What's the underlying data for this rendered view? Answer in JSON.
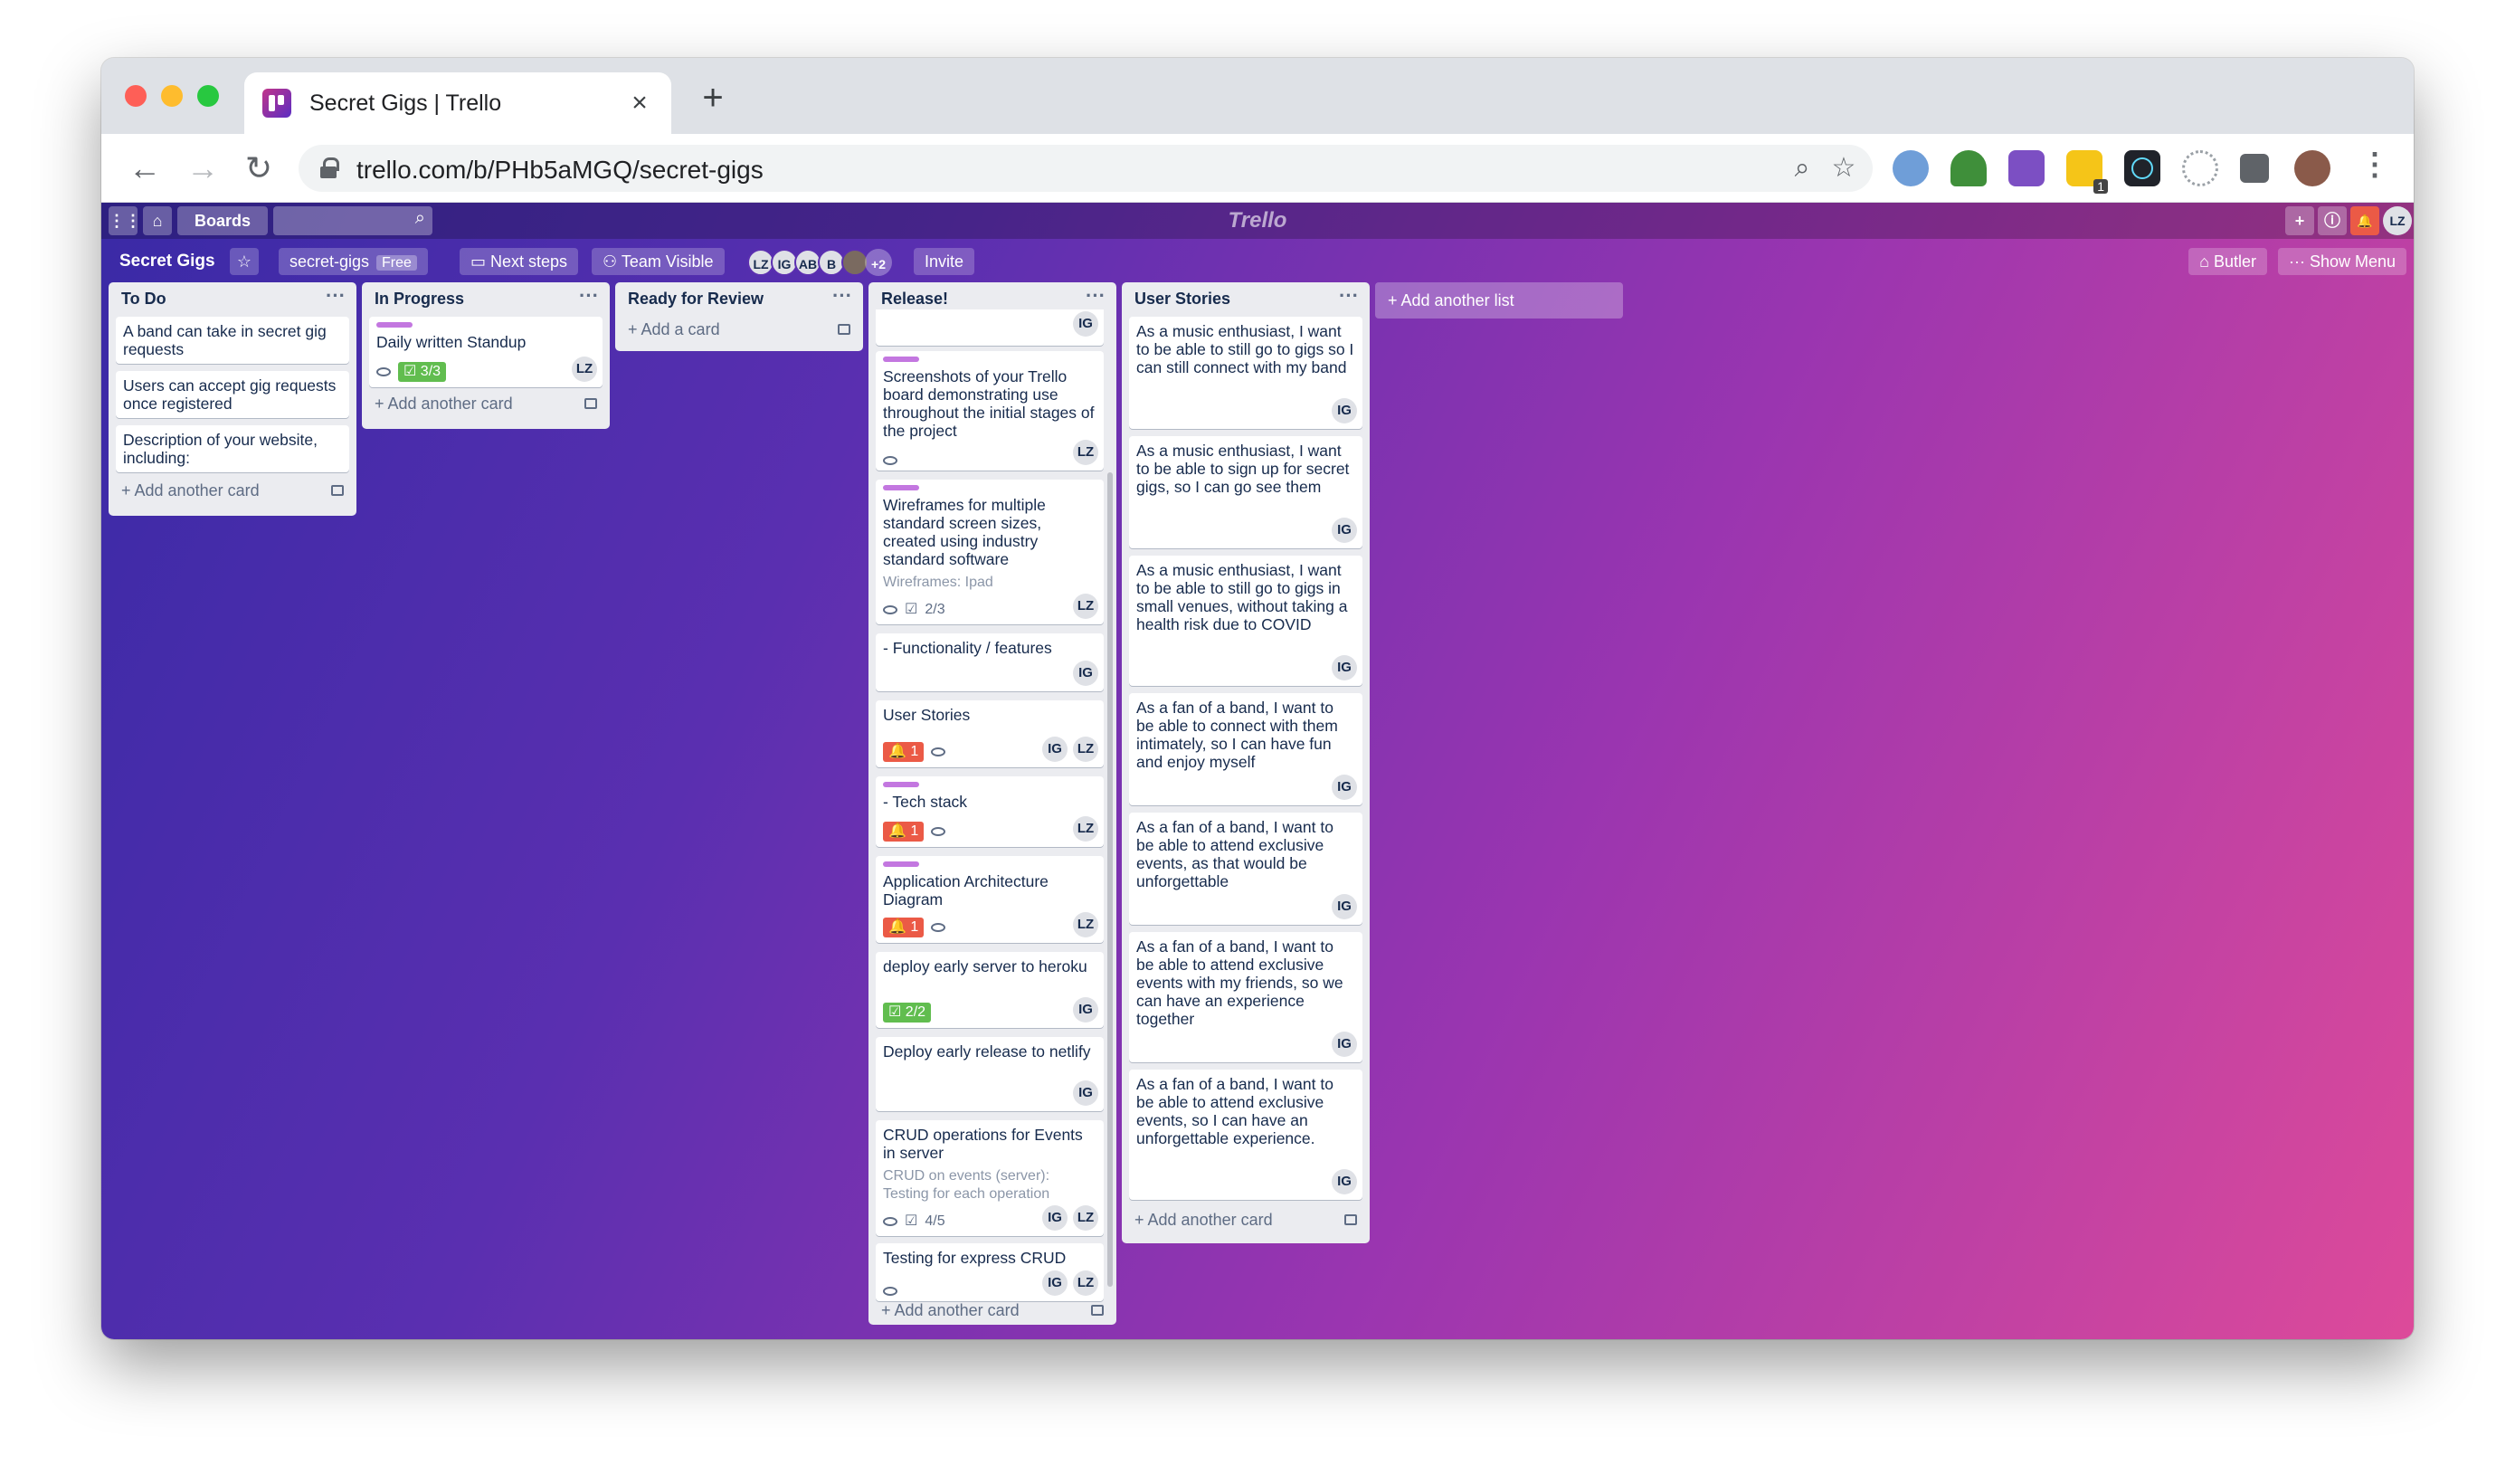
{
  "browser": {
    "tab_title": "Secret Gigs | Trello",
    "tab_close": "×",
    "new_tab": "+",
    "url": "trello.com/b/PHb5aMGQ/secret-gigs",
    "back": "←",
    "forward": "→",
    "reload": "↻",
    "zoom_icon": "⌕",
    "star_icon": "☆",
    "extension_badge": "1",
    "menu": "⋮"
  },
  "header": {
    "boards_label": "Boards",
    "logo": "Trello",
    "user_initials": "LZ",
    "search_icon": "⌕",
    "add_icon": "+",
    "info_icon": "ⓘ",
    "bell_icon": "🔔"
  },
  "board_bar": {
    "board_name": "Secret Gigs",
    "star": "☆",
    "team_name": "secret-gigs",
    "plan": "Free",
    "next_steps": "Next steps",
    "visibility": "Team Visible",
    "members": [
      "LZ",
      "IG",
      "AB",
      "B"
    ],
    "more_members": "+2",
    "invite": "Invite",
    "butler": "Butler",
    "show_menu": "Show Menu"
  },
  "lists": [
    {
      "title": "To Do",
      "cards": [
        {
          "text": "A band can take in secret gig requests"
        },
        {
          "text": "Users can accept gig requests once registered"
        },
        {
          "text": "Description of your website, including:"
        }
      ],
      "add_label": "+ Add another card"
    },
    {
      "title": "In Progress",
      "cards": [
        {
          "text": "Daily written Standup",
          "checklist": "3/3",
          "member": "LZ"
        }
      ],
      "add_label": "+ Add another card"
    },
    {
      "title": "Ready for Review",
      "cards": [],
      "add_label": "+ Add a card"
    },
    {
      "title": "Release!",
      "cards": [
        {
          "text": "",
          "members": [
            "IG"
          ]
        },
        {
          "text": "Screenshots of your Trello board demonstrating use throughout the initial stages of the project",
          "members": [
            "LZ"
          ]
        },
        {
          "text": "Wireframes for multiple standard screen sizes, created using industry standard software",
          "sub": "Wireframes: Ipad",
          "checklist": "2/3",
          "members": [
            "LZ"
          ]
        },
        {
          "text": "- Functionality / features",
          "members": [
            "IG"
          ]
        },
        {
          "text": "User Stories",
          "notify": "1",
          "members": [
            "IG",
            "LZ"
          ]
        },
        {
          "text": "- Tech stack",
          "notify": "1",
          "members": [
            "LZ"
          ]
        },
        {
          "text": "Application Architecture Diagram",
          "notify": "1",
          "members": [
            "LZ"
          ]
        },
        {
          "text": "deploy early server to heroku",
          "checklist": "2/2",
          "members": [
            "IG"
          ]
        },
        {
          "text": "Deploy early release to netlify",
          "members": [
            "IG"
          ]
        },
        {
          "text": "CRUD operations for Events in server",
          "sub": "CRUD on events (server): Testing for each operation",
          "checklist": "4/5",
          "members": [
            "IG",
            "LZ"
          ]
        },
        {
          "text": "Testing for express CRUD",
          "members": [
            "IG",
            "LZ"
          ]
        }
      ],
      "add_label": "+ Add another card"
    },
    {
      "title": "User Stories",
      "cards": [
        {
          "text": "As a music enthusiast, I want to be able to still go to gigs so I can still connect with my band",
          "member": "IG"
        },
        {
          "text": "As a music enthusiast, I want to be able to sign up for secret gigs, so I can go see them",
          "member": "IG"
        },
        {
          "text": "As a music enthusiast, I want to be able to still go to gigs in small venues, without taking a health risk due to COVID",
          "member": "IG"
        },
        {
          "text": "As a fan of a band, I want to be able to connect with them intimately, so I can have fun and enjoy myself",
          "member": "IG"
        },
        {
          "text": "As a fan of a band, I want to be able to attend exclusive events, as that would be unforgettable",
          "member": "IG"
        },
        {
          "text": "As a fan of a band, I want to be able to attend exclusive events with my friends, so we can have an experience together",
          "member": "IG"
        },
        {
          "text": "As a fan of a band, I want to be able to attend exclusive events, so I can have an unforgettable experience.",
          "member": "IG"
        }
      ],
      "add_label": "+ Add another card"
    }
  ],
  "add_list_label": "+ Add another list",
  "colors": {
    "label_purple": "#c377e0",
    "badge_green": "#61bd4f",
    "badge_red": "#eb5a46"
  }
}
